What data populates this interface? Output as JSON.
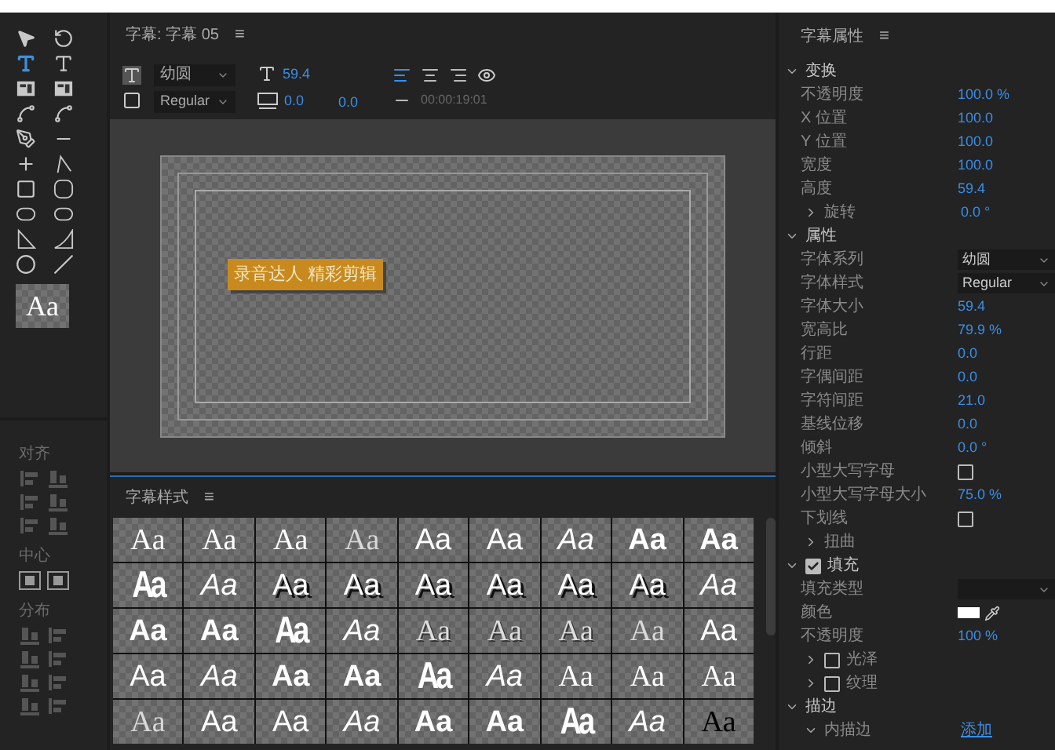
{
  "tools": {
    "items": [
      {
        "kind": "select",
        "selected": false
      },
      {
        "kind": "rotate",
        "selected": false
      },
      {
        "kind": "type",
        "selected": true
      },
      {
        "kind": "vtype",
        "selected": false
      },
      {
        "kind": "area",
        "selected": false
      },
      {
        "kind": "varea",
        "selected": false
      },
      {
        "kind": "path",
        "selected": false
      },
      {
        "kind": "vpath",
        "selected": false
      },
      {
        "kind": "pen",
        "selected": false
      },
      {
        "kind": "penminus",
        "selected": false
      },
      {
        "kind": "penplus",
        "selected": false
      },
      {
        "kind": "anchor",
        "selected": false
      },
      {
        "kind": "rect",
        "selected": false
      },
      {
        "kind": "roundrect",
        "selected": false
      },
      {
        "kind": "clipped",
        "selected": false
      },
      {
        "kind": "rounded",
        "selected": false
      },
      {
        "kind": "wedge",
        "selected": false
      },
      {
        "kind": "arc",
        "selected": false
      },
      {
        "kind": "ellipse",
        "selected": false
      },
      {
        "kind": "line",
        "selected": false
      }
    ],
    "style_preview": "Aa"
  },
  "align_panel": {
    "sections": [
      {
        "title": "对齐",
        "buttons": [
          {
            "kind": "horizontal"
          },
          {
            "kind": "vertical"
          },
          {
            "kind": "horizontal"
          },
          {
            "kind": "vertical"
          },
          {
            "kind": "horizontal"
          },
          {
            "kind": "vertical"
          }
        ]
      },
      {
        "title": "中心",
        "buttons": [
          {
            "kind": "center"
          },
          {
            "kind": "center"
          }
        ]
      },
      {
        "title": "分布",
        "buttons": [
          {
            "kind": "vertical"
          },
          {
            "kind": "horizontal"
          },
          {
            "kind": "vertical"
          },
          {
            "kind": "horizontal"
          },
          {
            "kind": "vertical"
          },
          {
            "kind": "horizontal"
          },
          {
            "kind": "vertical"
          },
          {
            "kind": "horizontal"
          }
        ]
      }
    ]
  },
  "title_panel": {
    "title": "字幕: 字幕 05",
    "menu": "≡",
    "font_family": "幼圆",
    "font_style": "Regular",
    "font_size": "59.4",
    "kerning": "0.0",
    "tracking": "0.0",
    "timecode": "00:00:19:01",
    "align": [
      {
        "selected": true
      },
      {
        "selected": false
      },
      {
        "selected": false
      }
    ],
    "canvas_text": "录音达人  精彩剪辑"
  },
  "styles_panel": {
    "title": "字幕样式",
    "menu": "≡",
    "styles": [
      {
        "sample": "Aa",
        "kind": "serif"
      },
      {
        "sample": "Aa",
        "kind": "serif"
      },
      {
        "sample": "Aa",
        "kind": "serif"
      },
      {
        "sample": "Aa",
        "kind": "light"
      },
      {
        "sample": "Aa",
        "kind": "sans"
      },
      {
        "sample": "Aa",
        "kind": "sans"
      },
      {
        "sample": "Aa",
        "kind": "italic"
      },
      {
        "sample": "Aa",
        "kind": "bold"
      },
      {
        "sample": "Aa",
        "kind": "bold"
      },
      {
        "sample": "Aa",
        "kind": "condensed"
      },
      {
        "sample": "Aa",
        "kind": "italic"
      },
      {
        "sample": "Aa",
        "kind": "shadow"
      },
      {
        "sample": "Aa",
        "kind": "shadow"
      },
      {
        "sample": "Aa",
        "kind": "shadow"
      },
      {
        "sample": "Aa",
        "kind": "shadow"
      },
      {
        "sample": "Aa",
        "kind": "shadow"
      },
      {
        "sample": "Aa",
        "kind": "shadow"
      },
      {
        "sample": "Aa",
        "kind": "italic"
      },
      {
        "sample": "Aa",
        "kind": "bold"
      },
      {
        "sample": "Aa",
        "kind": "bold"
      },
      {
        "sample": "Aa",
        "kind": "condensed"
      },
      {
        "sample": "Aa",
        "kind": "italic"
      },
      {
        "sample": "Aa",
        "kind": "outline"
      },
      {
        "sample": "Aa",
        "kind": "outline"
      },
      {
        "sample": "Aa",
        "kind": "outline"
      },
      {
        "sample": "Aa",
        "kind": "light"
      },
      {
        "sample": "Aa",
        "kind": "sans"
      },
      {
        "sample": "Aa",
        "kind": "sans"
      },
      {
        "sample": "Aa",
        "kind": "italic"
      },
      {
        "sample": "Aa",
        "kind": "bold"
      },
      {
        "sample": "Aa",
        "kind": "bold"
      },
      {
        "sample": "Aa",
        "kind": "condensed"
      },
      {
        "sample": "Aa",
        "kind": "italic"
      },
      {
        "sample": "Aa",
        "kind": "serif"
      },
      {
        "sample": "Aa",
        "kind": "serif"
      },
      {
        "sample": "Aa",
        "kind": "serif"
      },
      {
        "sample": "Aa",
        "kind": "light"
      },
      {
        "sample": "Aa",
        "kind": "sans"
      },
      {
        "sample": "Aa",
        "kind": "sans"
      },
      {
        "sample": "Aa",
        "kind": "italic"
      },
      {
        "sample": "Aa",
        "kind": "bold"
      },
      {
        "sample": "Aa",
        "kind": "bold"
      },
      {
        "sample": "Aa",
        "kind": "condensed"
      },
      {
        "sample": "Aa",
        "kind": "italic"
      },
      {
        "sample": "Aa",
        "kind": "dark"
      }
    ]
  },
  "properties": {
    "title": "字幕属性",
    "menu": "≡",
    "rows": [
      {
        "kind": "section",
        "label": "变换",
        "expanded": true
      },
      {
        "kind": "value",
        "label": "不透明度",
        "value": "100.0 %"
      },
      {
        "kind": "value",
        "label": "X 位置",
        "value": "100.0"
      },
      {
        "kind": "value",
        "label": "Y 位置",
        "value": "100.0"
      },
      {
        "kind": "value",
        "label": "宽度",
        "value": "100.0"
      },
      {
        "kind": "value",
        "label": "高度",
        "value": "59.4"
      },
      {
        "kind": "group",
        "label": "旋转",
        "value": "0.0 °",
        "expanded": false
      },
      {
        "kind": "section",
        "label": "属性",
        "expanded": true
      },
      {
        "kind": "select",
        "label": "字体系列",
        "value": "幼圆"
      },
      {
        "kind": "select",
        "label": "字体样式",
        "value": "Regular"
      },
      {
        "kind": "value",
        "label": "字体大小",
        "value": "59.4"
      },
      {
        "kind": "value",
        "label": "宽高比",
        "value": "79.9 %"
      },
      {
        "kind": "value",
        "label": "行距",
        "value": "0.0"
      },
      {
        "kind": "value",
        "label": "字偶间距",
        "value": "0.0"
      },
      {
        "kind": "value",
        "label": "字符间距",
        "value": "21.0"
      },
      {
        "kind": "value",
        "label": "基线位移",
        "value": "0.0"
      },
      {
        "kind": "value",
        "label": "倾斜",
        "value": "0.0 °"
      },
      {
        "kind": "value",
        "label": "小型大写字母",
        "checked": false
      },
      {
        "kind": "value",
        "label": "小型大写字母大小",
        "value": "75.0 %"
      },
      {
        "kind": "value",
        "label": "下划线",
        "checked": false
      },
      {
        "kind": "group",
        "label": "扭曲",
        "expanded": false
      },
      {
        "kind": "section",
        "label": "填充",
        "expanded": true,
        "checked": true
      },
      {
        "kind": "select",
        "label": "填充类型"
      },
      {
        "kind": "value",
        "label": "颜色",
        "color": "#ffffff"
      },
      {
        "kind": "value",
        "label": "不透明度",
        "value": "100 %"
      },
      {
        "kind": "group",
        "label": "光泽",
        "expanded": false,
        "checked": false
      },
      {
        "kind": "group",
        "label": "纹理",
        "expanded": false,
        "checked": false
      },
      {
        "kind": "section",
        "label": "描边",
        "expanded": true
      },
      {
        "kind": "group",
        "label": "内描边",
        "expanded": true,
        "link": "添加"
      }
    ]
  }
}
